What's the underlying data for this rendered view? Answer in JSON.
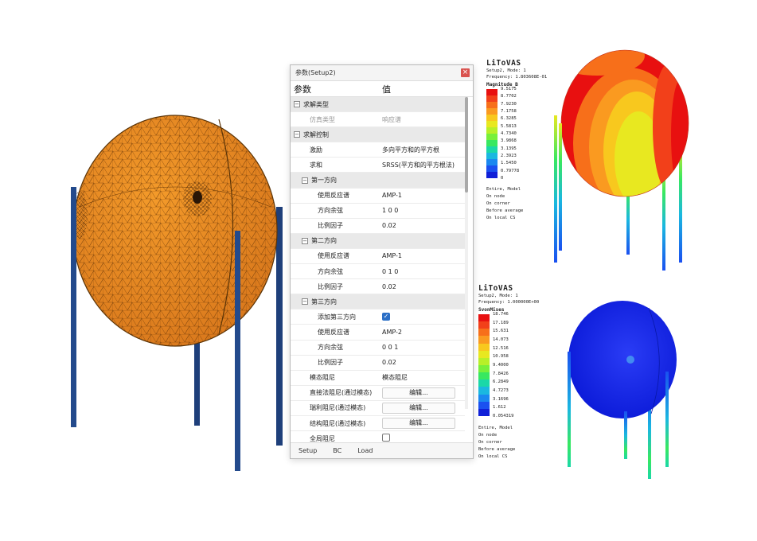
{
  "dialog": {
    "title": "参数(Setup2)",
    "close_glyph": "×",
    "header": {
      "param": "参数",
      "value": "值"
    },
    "rows": [
      {
        "type": "cat",
        "indent": 0,
        "toggle": "−",
        "label": "求解类型",
        "value": ""
      },
      {
        "type": "prop",
        "indent": 2,
        "label": "仿真类型",
        "value": "响应谱",
        "dim": true
      },
      {
        "type": "cat",
        "indent": 0,
        "toggle": "−",
        "label": "求解控制",
        "value": ""
      },
      {
        "type": "prop",
        "indent": 2,
        "label": "激励",
        "value": "多向平方和的平方根"
      },
      {
        "type": "prop",
        "indent": 2,
        "label": "求和",
        "value": "SRSS(平方和的平方根法)"
      },
      {
        "type": "cat",
        "indent": 1,
        "toggle": "−",
        "label": "第一方向",
        "value": ""
      },
      {
        "type": "prop",
        "indent": 3,
        "label": "使用反应谱",
        "value": "AMP-1"
      },
      {
        "type": "prop",
        "indent": 3,
        "label": "方向余弦",
        "value": "1 0 0"
      },
      {
        "type": "prop",
        "indent": 3,
        "label": "比例因子",
        "value": "0.02"
      },
      {
        "type": "cat",
        "indent": 1,
        "toggle": "−",
        "label": "第二方向",
        "value": ""
      },
      {
        "type": "prop",
        "indent": 3,
        "label": "使用反应谱",
        "value": "AMP-1"
      },
      {
        "type": "prop",
        "indent": 3,
        "label": "方向余弦",
        "value": "0 1 0"
      },
      {
        "type": "prop",
        "indent": 3,
        "label": "比例因子",
        "value": "0.02"
      },
      {
        "type": "cat",
        "indent": 1,
        "toggle": "−",
        "label": "第三方向",
        "value": ""
      },
      {
        "type": "check",
        "indent": 3,
        "label": "添加第三方向",
        "checked": true
      },
      {
        "type": "prop",
        "indent": 3,
        "label": "使用反应谱",
        "value": "AMP-2"
      },
      {
        "type": "prop",
        "indent": 3,
        "label": "方向余弦",
        "value": "0 0 1"
      },
      {
        "type": "prop",
        "indent": 3,
        "label": "比例因子",
        "value": "0.02"
      },
      {
        "type": "prop",
        "indent": 2,
        "label": "模态阻尼",
        "value": "模态阻尼"
      },
      {
        "type": "button",
        "indent": 2,
        "label": "直接法阻尼(通过模态)",
        "value": "编辑..."
      },
      {
        "type": "button",
        "indent": 2,
        "label": "瑞利阻尼(通过模态)",
        "value": "编辑..."
      },
      {
        "type": "button",
        "indent": 2,
        "label": "结构阻尼(通过模态)",
        "value": "编辑..."
      },
      {
        "type": "check",
        "indent": 2,
        "label": "全局阻尼",
        "checked": false
      }
    ],
    "tabs": [
      "Setup",
      "BC",
      "Load"
    ]
  },
  "result_top": {
    "brand": "LiToVAS",
    "setup_line": "Setup2, Mode: 1",
    "frequency_line": "Frequency: 1.803608E-01",
    "quantity": "Magnitude_B",
    "colors": [
      "#e81010",
      "#f2401a",
      "#f76f1a",
      "#fa9a20",
      "#f8c81e",
      "#e8e820",
      "#b8f028",
      "#78f03a",
      "#38e860",
      "#1ad8a8",
      "#1ab8e0",
      "#1a88f0",
      "#1a50f0",
      "#1020d8"
    ],
    "labels": [
      "9.5175",
      "8.7702",
      "7.9230",
      "7.1758",
      "6.3285",
      "5.5813",
      "4.7340",
      "3.9868",
      "3.1395",
      "2.3923",
      "1.5450",
      "0.79778",
      "0"
    ],
    "footer": [
      "Entire, Model",
      "On node",
      "On corner",
      "Before average",
      "On local CS"
    ]
  },
  "result_bottom": {
    "brand": "LiToVAS",
    "setup_line": "Setup2, Mode: 1",
    "frequency_line": "Frequency: 1.000000E+00",
    "quantity": "SvonMises",
    "colors": [
      "#e81010",
      "#f2401a",
      "#f76f1a",
      "#fa9a20",
      "#f8c81e",
      "#e8e820",
      "#b8f028",
      "#78f03a",
      "#38e860",
      "#1ad8a8",
      "#1ab8e0",
      "#1a88f0",
      "#1a50f0",
      "#1020d8"
    ],
    "labels": [
      "18.746",
      "17.189",
      "15.631",
      "14.073",
      "12.516",
      "10.958",
      "9.4000",
      "7.8426",
      "6.2849",
      "4.7273",
      "3.1696",
      "1.612",
      "0.054319"
    ],
    "footer": [
      "Entire, Model",
      "On node",
      "On corner",
      "Before average",
      "On local CS"
    ]
  }
}
